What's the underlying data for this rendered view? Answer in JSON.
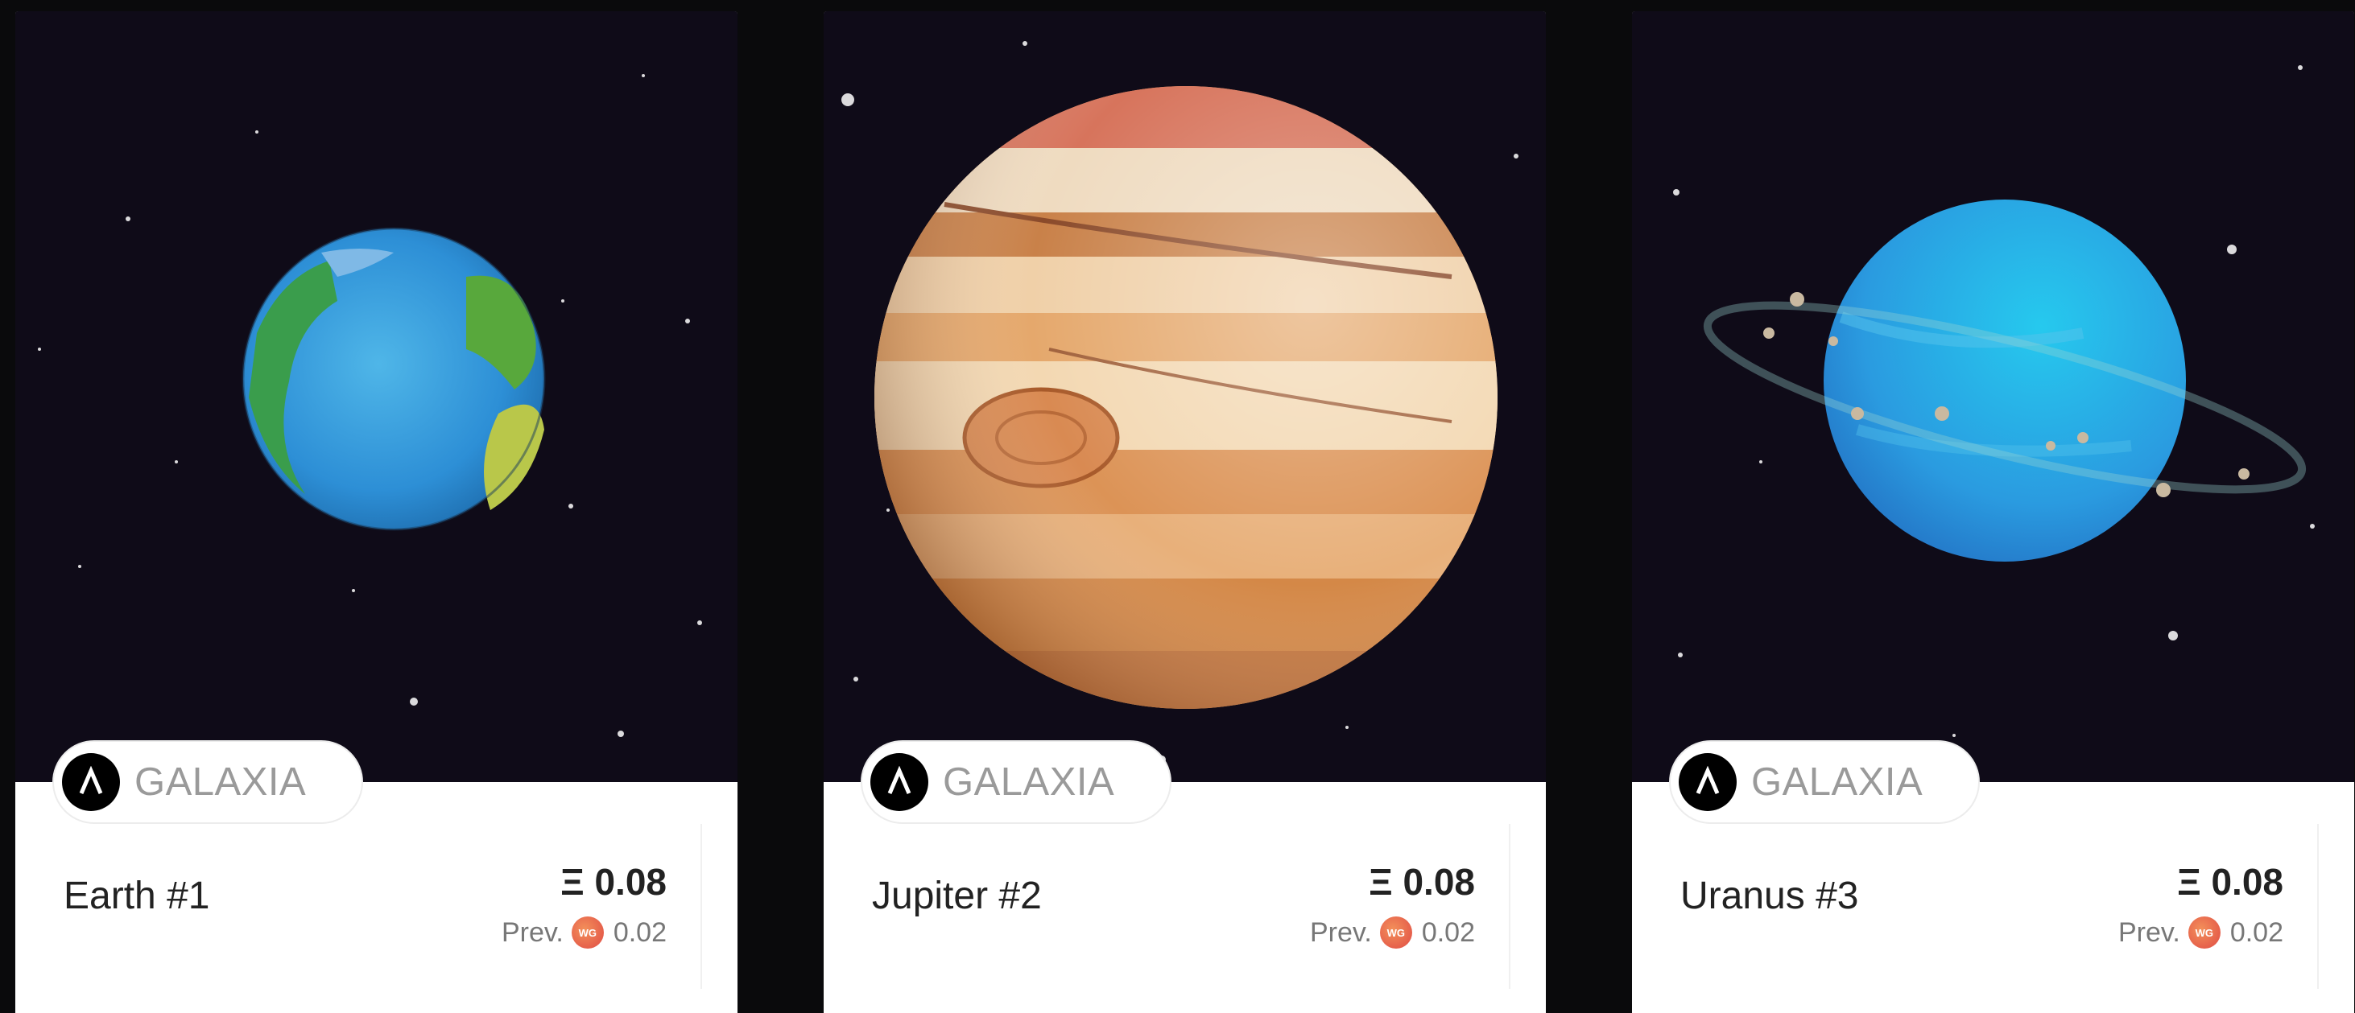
{
  "cards": [
    {
      "title": "Earth #1",
      "collection": "GALAXIA",
      "price": "Ξ 0.08",
      "prev_label": "Prev.",
      "prev_value": "0.02",
      "prev_coin": "WG",
      "planet": "earth"
    },
    {
      "title": "Jupiter #2",
      "collection": "GALAXIA",
      "price": "Ξ 0.08",
      "prev_label": "Prev.",
      "prev_value": "0.02",
      "prev_coin": "WG",
      "planet": "jupiter"
    },
    {
      "title": "Uranus #3",
      "collection": "GALAXIA",
      "price": "Ξ 0.08",
      "prev_label": "Prev.",
      "prev_value": "0.02",
      "prev_coin": "WG",
      "planet": "uranus"
    }
  ],
  "colors": {
    "background": "#0a0a0c",
    "space": "#0f0b18",
    "chip_text": "#9a9a9a",
    "coin": "#e04b45"
  }
}
